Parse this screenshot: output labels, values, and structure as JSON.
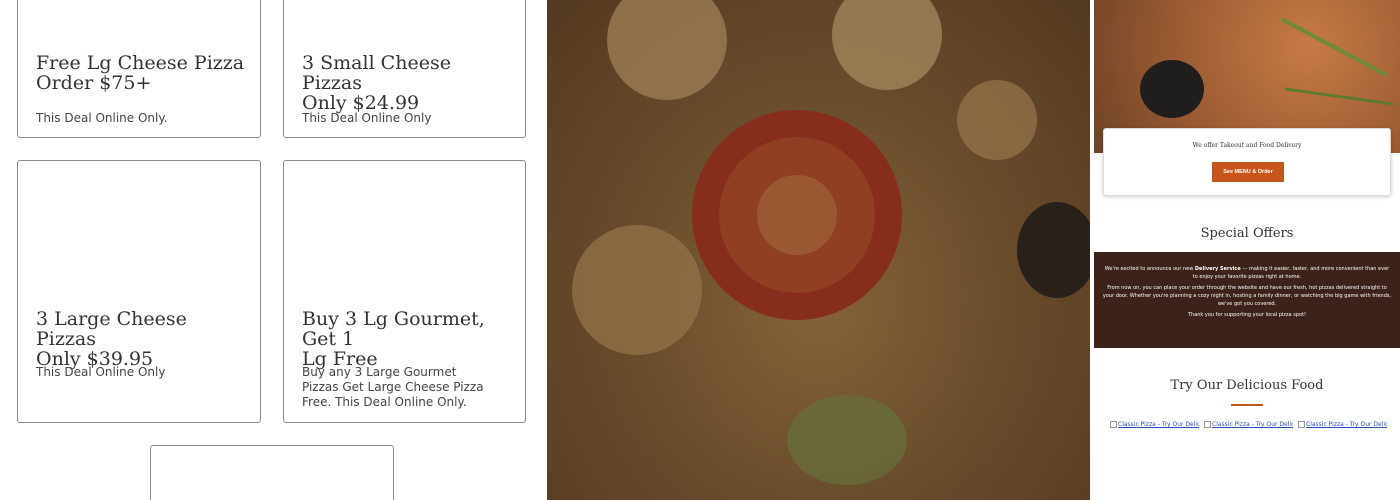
{
  "deals": [
    {
      "title_line1": "Free Lg Cheese Pizza",
      "title_line2": "Order $75+",
      "description": "This Deal Online Only."
    },
    {
      "title_line1": "3 Small Cheese Pizzas",
      "title_line2": "Only $24.99",
      "description": "This Deal Online Only"
    },
    {
      "title_line1": "3 Large Cheese Pizzas",
      "title_line2": "Only $39.95",
      "description": "This Deal Online Only"
    },
    {
      "title_line1": "Buy 3 Lg Gourmet, Get 1",
      "title_line2": "Lg Free",
      "description": "Buy any 3 Large Gourmet Pizzas Get Large Cheese Pizza Free. This Deal Online Only."
    }
  ],
  "site": {
    "promo_text": "We offer Takeout and Food Delivery",
    "menu_button_label": "See MENU & Order",
    "special_offers_title": "Special Offers",
    "delivery": {
      "intro_before": "We're excited to announce our new ",
      "intro_bold": "Delivery Service",
      "intro_after": " — making it easier, faster, and more convenient than ever to enjoy your favorite pizzas right at home.",
      "paragraph2": "From now on, you can place your order through the website and have our fresh, hot pizzas delivered straight to your door. Whether you're planning a cozy night in, hosting a family dinner, or watching the big game with friends, we've got you covered.",
      "paragraph3": "Thank you for supporting your local pizza spot!"
    },
    "food_title": "Try Our Delicious Food",
    "thumbs": [
      "Classic Pizza - Try Our Delic",
      "Classic Pizza - Try Our Delic",
      "Classic Pizza - Try Our Delic"
    ]
  },
  "colors": {
    "accent": "#c6561a",
    "delivery_bg": "#3d2219",
    "link": "#2b4fb5"
  }
}
